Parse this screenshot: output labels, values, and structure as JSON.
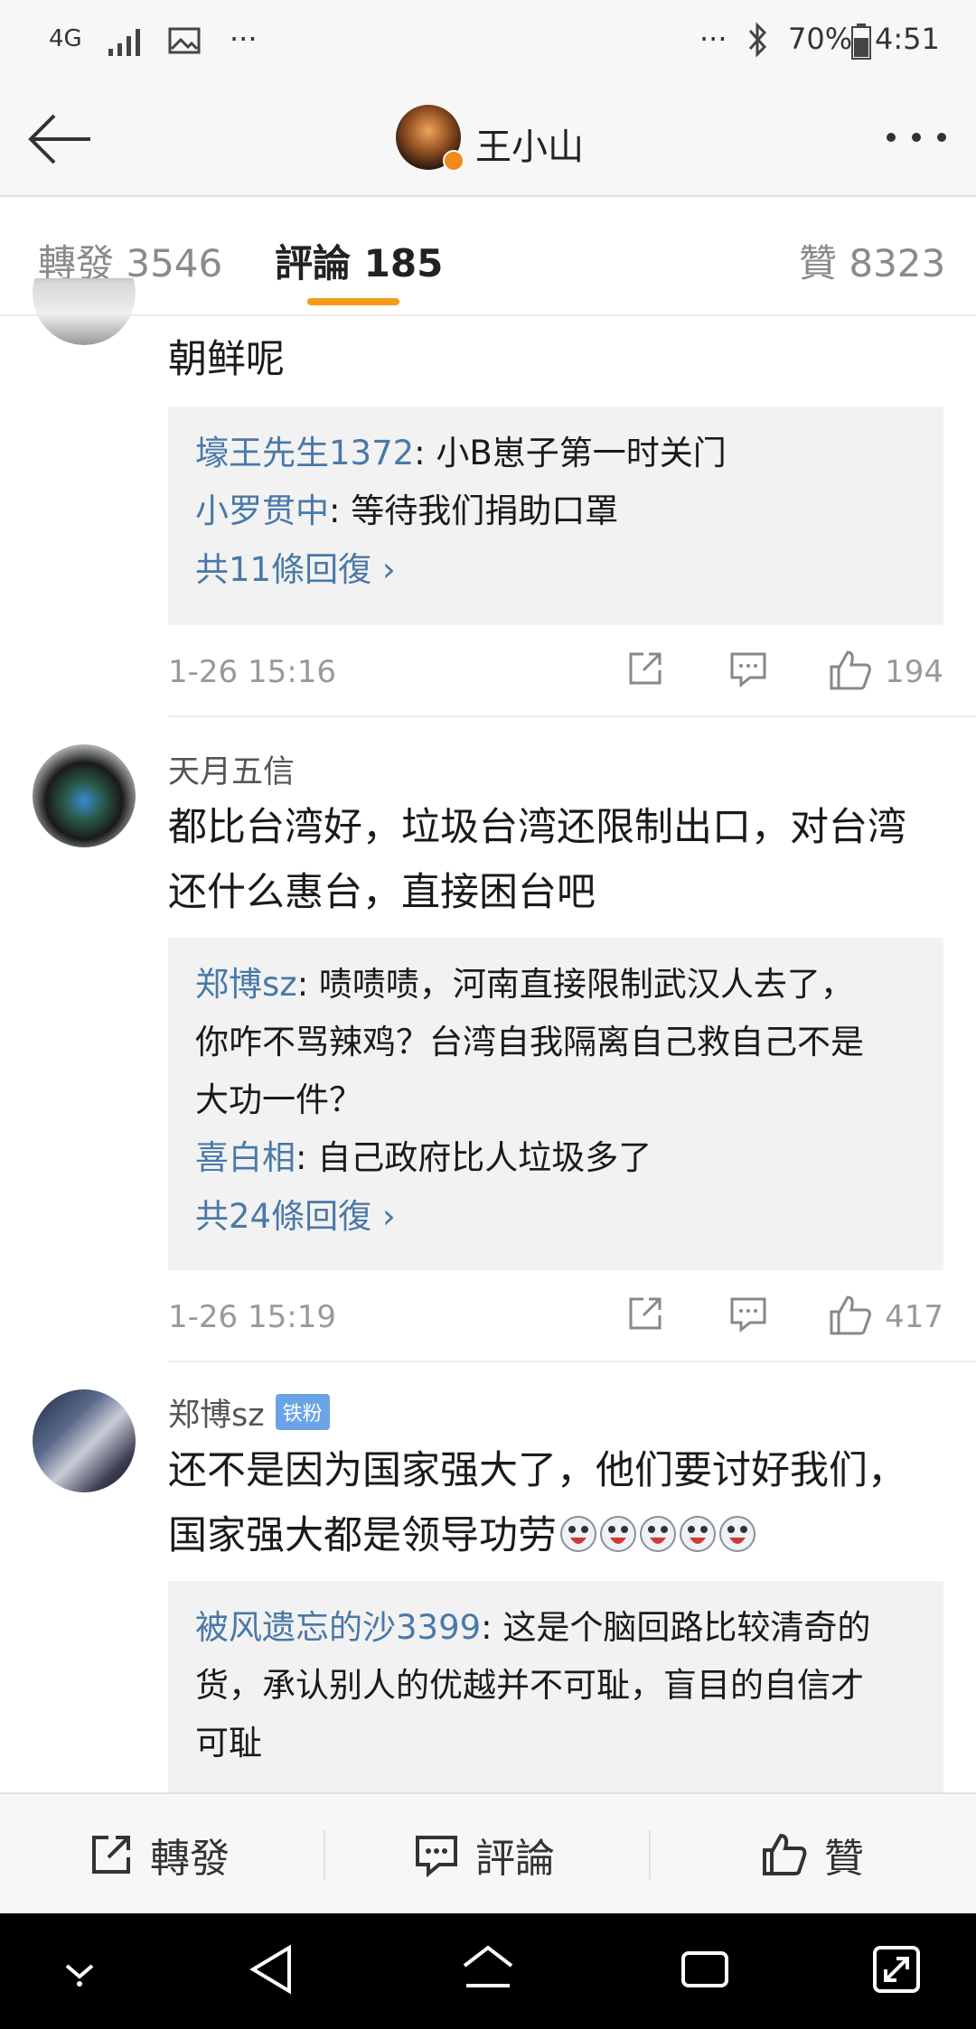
{
  "status_bar": {
    "network": "4G",
    "right_dots": "···",
    "left_dots": "···",
    "battery": "70%",
    "time": "4:51"
  },
  "nav": {
    "title": "王小山"
  },
  "tabs": [
    {
      "label": "轉發 3546"
    },
    {
      "label": "評論 185"
    },
    {
      "label": "贊 8323"
    }
  ],
  "comments": [
    {
      "text": "朝鲜呢",
      "replies": [
        {
          "user": "壕王先生1372",
          "text": ": 小B崽子第一时关门"
        },
        {
          "user": "小罗贯中",
          "text": ": 等待我们捐助口罩"
        }
      ],
      "more": "共11條回復 ›",
      "time": "1-26 15:16",
      "likes": "194"
    },
    {
      "user": "天月五信",
      "text_line1": "都比台湾好，垃圾台湾还限制出口，对台湾",
      "text_line2": "还什么惠台，直接困台吧",
      "replies": [
        {
          "user": "郑博sz",
          "text": ": 啧啧啧，河南直接限制武汉人去了，",
          "line2": "你咋不骂辣鸡？台湾自我隔离自己救自己不是",
          "line3": "大功一件？"
        },
        {
          "user": "喜白相",
          "text": ": 自己政府比人垃圾多了"
        }
      ],
      "more": "共24條回復 ›",
      "time": "1-26 15:19",
      "likes": "417"
    },
    {
      "user": "郑博sz",
      "badge": "铁粉",
      "text_line1": "还不是因为国家强大了，他们要讨好我们，",
      "text_line2": "国家强大都是领导功劳",
      "replies": [
        {
          "user": "被风遗忘的沙3399",
          "text": ": 这是个脑回路比较清奇的",
          "line2": "货，承认别人的优越并不可耻，盲目的自信才",
          "line3": "可耻"
        }
      ]
    }
  ],
  "bottom_bar": {
    "repost": "轉發",
    "comment": "評論",
    "like": "贊"
  },
  "colors": {
    "accent": "#f59b1a",
    "link": "#4a78a8",
    "reply_bg": "#f2f2f2"
  }
}
